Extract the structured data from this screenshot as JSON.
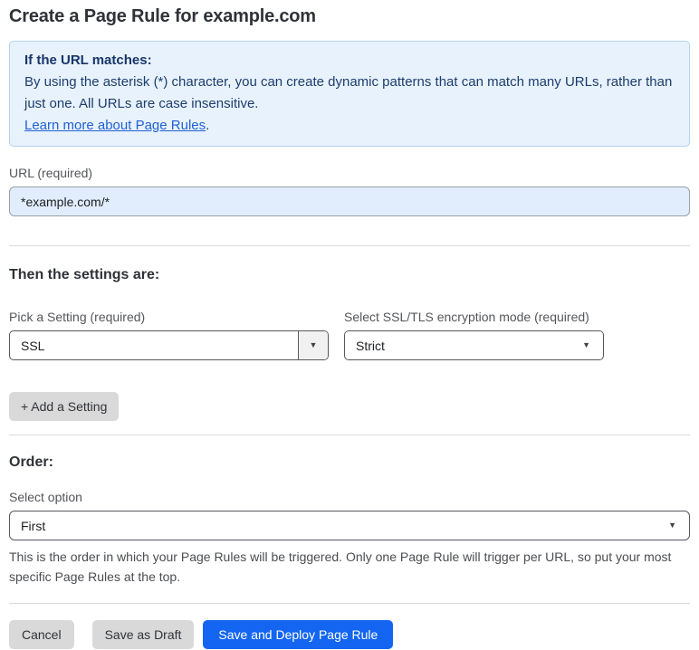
{
  "page": {
    "title": "Create a Page Rule for example.com"
  },
  "info_box": {
    "heading": "If the URL matches:",
    "body": "By using the asterisk (*) character, you can create dynamic patterns that can match many URLs, rather than just one. All URLs are case insensitive.",
    "link": "Learn more about Page Rules",
    "link_suffix": "."
  },
  "url_field": {
    "label": "URL (required)",
    "value": "*example.com/*"
  },
  "settings": {
    "heading": "Then the settings are:",
    "setting_select": {
      "label": "Pick a Setting (required)",
      "value": "SSL"
    },
    "mode_select": {
      "label": "Select SSL/TLS encryption mode (required)",
      "value": "Strict"
    },
    "add_button": "+ Add a Setting"
  },
  "order": {
    "heading": "Order:",
    "select_label": "Select option",
    "value": "First",
    "help": "This is the order in which your Page Rules will be triggered. Only one Page Rule will trigger per URL, so put your most specific Page Rules at the top."
  },
  "actions": {
    "cancel": "Cancel",
    "save_draft": "Save as Draft",
    "save_deploy": "Save and Deploy Page Rule"
  },
  "icons": {
    "dropdown_arrow": "▼"
  },
  "colors": {
    "accent_blue": "#1466f2",
    "info_background": "#e8f2fc",
    "info_border": "#b0d4f1",
    "info_text": "#1c3d6d",
    "link_blue": "#2161d2",
    "input_background": "#e1edfc",
    "button_gray": "#d9d9d9",
    "divider": "#dcdcdc"
  }
}
